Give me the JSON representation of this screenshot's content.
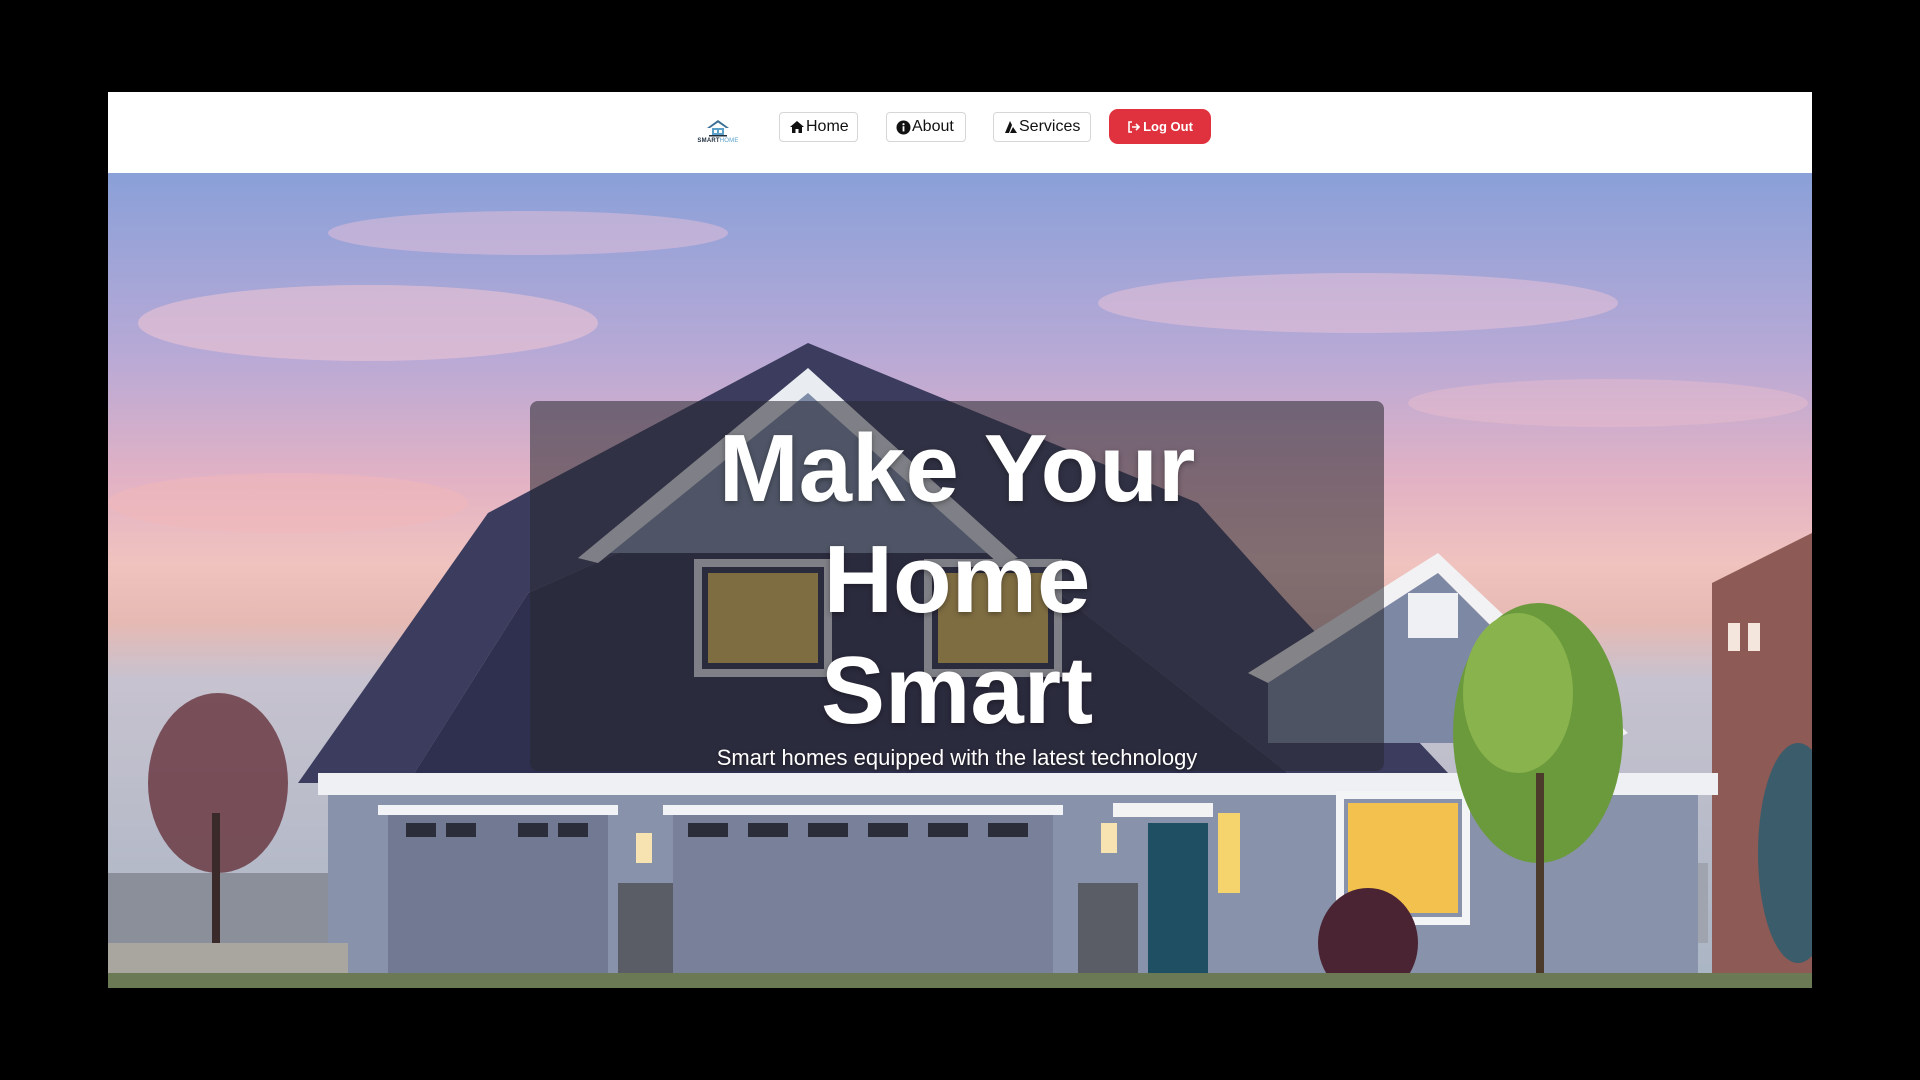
{
  "brand": {
    "logo_text_main": "SMART",
    "logo_text_accent": "HOME",
    "logo_icon": "house-logo-icon"
  },
  "nav": {
    "home": {
      "label": "Home",
      "icon": "home-icon"
    },
    "about": {
      "label": "About",
      "icon": "info-icon"
    },
    "services": {
      "label": "Services",
      "icon": "services-icon"
    },
    "logout": {
      "label": "Log Out",
      "icon": "logout-icon"
    }
  },
  "hero": {
    "headline_line1": "Make Your",
    "headline_line2": "Home",
    "headline_line3": "Smart",
    "subheadline": "Smart homes equipped with the latest technology"
  },
  "colors": {
    "logout_bg": "#e0323e",
    "page_bg": "#000000",
    "navbar_bg": "#ffffff"
  }
}
